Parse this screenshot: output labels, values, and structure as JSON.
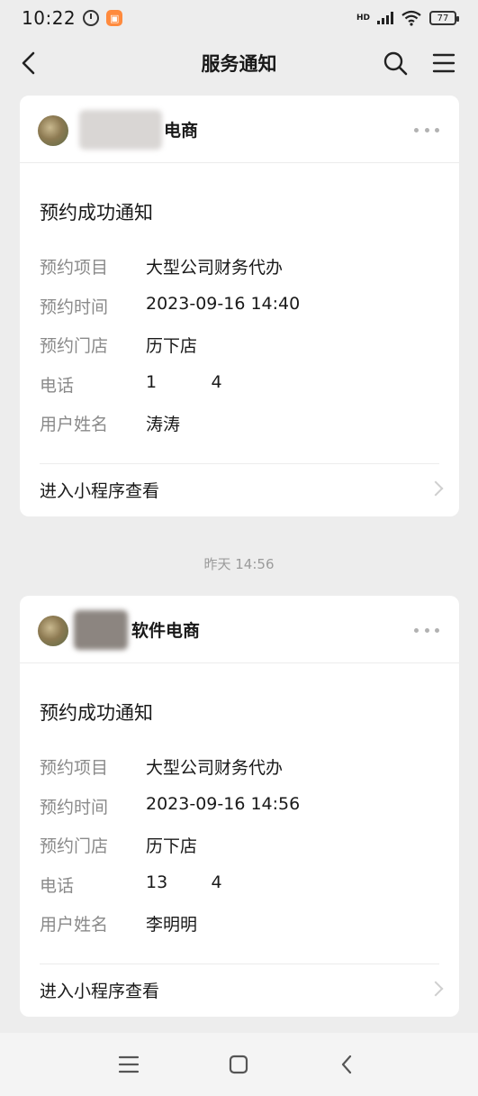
{
  "status_bar": {
    "time": "10:22",
    "network_label": "HD",
    "battery": "77"
  },
  "nav": {
    "title": "服务通知"
  },
  "cards": [
    {
      "sender_name": "电商",
      "title": "预约成功通知",
      "fields": [
        {
          "label": "预约项目",
          "value": "大型公司财务代办"
        },
        {
          "label": "预约时间",
          "value": "2023-09-16 14:40"
        },
        {
          "label": "预约门店",
          "value": "历下店"
        },
        {
          "label": "电话",
          "value": "1          4"
        },
        {
          "label": "用户姓名",
          "value": "涛涛"
        }
      ],
      "link_label": "进入小程序查看"
    },
    {
      "sender_name": "软件电商",
      "title": "预约成功通知",
      "fields": [
        {
          "label": "预约项目",
          "value": "大型公司财务代办"
        },
        {
          "label": "预约时间",
          "value": "2023-09-16 14:56"
        },
        {
          "label": "预约门店",
          "value": "历下店"
        },
        {
          "label": "电话",
          "value": "13        4"
        },
        {
          "label": "用户姓名",
          "value": "李明明"
        }
      ],
      "link_label": "进入小程序查看"
    }
  ],
  "timestamp": "昨天 14:56",
  "icons": {
    "back": "chevron-left-icon",
    "search": "search-icon",
    "menu": "hamburger-menu-icon",
    "more": "more-dots-icon",
    "alarm": "alarm-clock-icon",
    "signal": "signal-icon",
    "wifi": "wifi-icon",
    "battery": "battery-icon"
  },
  "colors": {
    "background": "#ededed",
    "card": "#ffffff",
    "label": "#8a8a8a",
    "timestamp": "#9b9b9b"
  }
}
